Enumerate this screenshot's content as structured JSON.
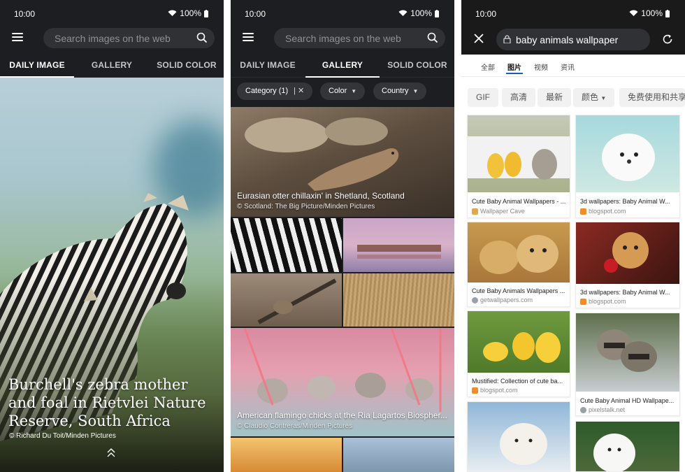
{
  "status": {
    "time": "10:00",
    "battery": "100%"
  },
  "panel1": {
    "search_placeholder": "Search images on the web",
    "tabs": [
      "DAILY IMAGE",
      "GALLERY",
      "SOLID COLOR"
    ],
    "active_tab": 0,
    "caption": "Burchell's zebra mother and foal in Rietvlei Nature Reserve, South Africa",
    "credit": "Richard Du Toit/Minden Pictures"
  },
  "panel2": {
    "search_placeholder": "Search images on the web",
    "tabs": [
      "DAILY IMAGE",
      "GALLERY",
      "SOLID COLOR"
    ],
    "active_tab": 1,
    "chips": {
      "category": "Category (1)",
      "color": "Color",
      "country": "Country"
    },
    "photos": [
      {
        "caption": "Eurasian otter chillaxin' in Shetland, Scotland",
        "credit": "Scotland: The Big Picture/Minden Pictures"
      },
      {
        "caption": "American flamingo chicks at the Ria Lagartos Biospher...",
        "credit": "Claudio Contreras/Minden Pictures"
      }
    ]
  },
  "panel3": {
    "query": "baby animals wallpaper",
    "search_tabs": [
      "全部",
      "图片",
      "视频",
      "资讯"
    ],
    "active_search_tab": 1,
    "filters": [
      "GIF",
      "高清",
      "最新",
      "颜色",
      "免费使用和共享"
    ],
    "results": [
      {
        "title": "Cute Baby Animal Wallpapers - ...",
        "source": "Wallpaper Cave",
        "favicon_color": "#e0a84b"
      },
      {
        "title": "3d wallpapers: Baby Animal W...",
        "source": "blogspot.com",
        "favicon_color": "#f28c28"
      },
      {
        "title": "Cute Baby Animals Wallpapers ...",
        "source": "getwallpapers.com",
        "favicon_color": "#9aa0a6"
      },
      {
        "title": "3d wallpapers: Baby Animal W...",
        "source": "blogspot.com",
        "favicon_color": "#f28c28"
      },
      {
        "title": "Mustified: Collection of cute ba...",
        "source": "blogspot.com",
        "favicon_color": "#f28c28"
      },
      {
        "title": "Cute Baby Animal HD Wallpape...",
        "source": "pixelstalk.net",
        "favicon_color": "#9aa0a6"
      }
    ]
  }
}
